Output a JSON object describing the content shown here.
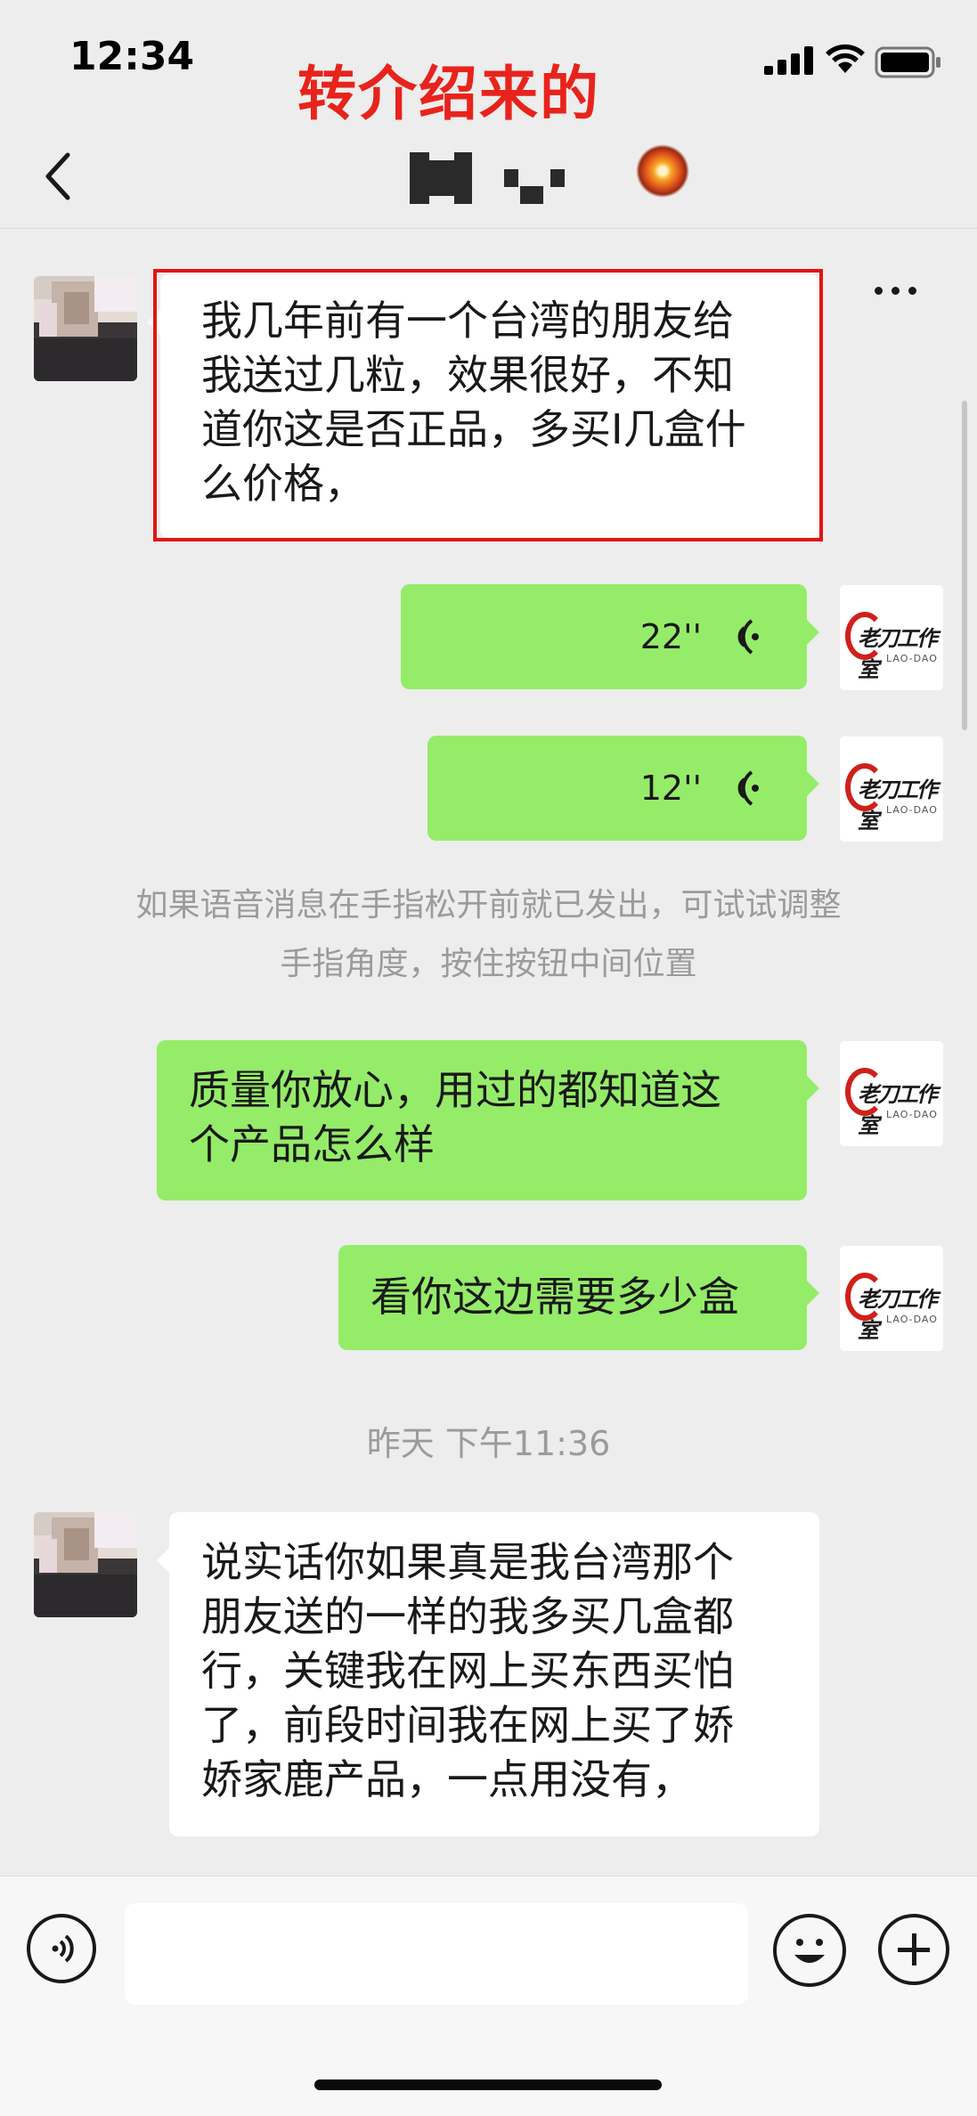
{
  "status_bar": {
    "time": "12:34",
    "overlay_caption": "转介绍来的",
    "overlay_color": "#e8231c"
  },
  "nav": {
    "back_icon": "chevron-left-icon",
    "title_redacted": true,
    "more_icon": "more-dots-icon"
  },
  "messages": [
    {
      "side": "in",
      "type": "text",
      "highlighted": true,
      "text_lines": [
        "我几年前有一个台湾的朋友给",
        "我送过几粒，效果很好，不知",
        "道你这是否正品，多买I几盒什",
        "么价格，"
      ]
    },
    {
      "side": "out",
      "type": "voice",
      "duration": "22''"
    },
    {
      "side": "out",
      "type": "voice",
      "duration": "12''"
    },
    {
      "side": "system",
      "text_lines": [
        "如果语音消息在手指松开前就已发出，可试试调整",
        "手指角度，按住按钮中间位置"
      ]
    },
    {
      "side": "out",
      "type": "text",
      "text_lines": [
        "质量你放心，用过的都知道这",
        "个产品怎么样"
      ]
    },
    {
      "side": "out",
      "type": "text",
      "text_lines": [
        "看你这边需要多少盒"
      ]
    },
    {
      "side": "timestamp",
      "text": "昨天 下午11:36"
    },
    {
      "side": "in",
      "type": "text",
      "text_lines": [
        "说实话你如果真是我台湾那个",
        "朋友送的一样的我多买几盒都",
        "行，关键我在网上买东西买怕",
        "了，前段时间我在网上买了娇",
        "娇家鹿产品，一点用没有，"
      ]
    }
  ],
  "self_avatar": {
    "logo_text": "老刀工作室",
    "logo_subtext": "LAO-DAO",
    "logo_color": "#d0201b"
  },
  "input_bar": {
    "voice_icon": "voice-mode-icon",
    "input_value": "",
    "emoji_icon": "smiley-icon",
    "plus_icon": "plus-circle-icon"
  },
  "colors": {
    "background": "#ededed",
    "outgoing_bubble": "#95ec69",
    "incoming_bubble": "#ffffff",
    "highlight_frame": "#e3150e"
  }
}
